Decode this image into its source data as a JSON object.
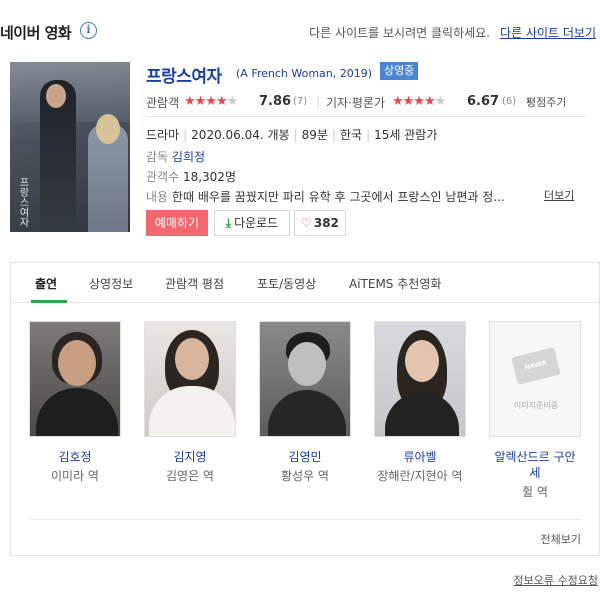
{
  "header": {
    "brand": "네이버 영화",
    "info_icon": "info-icon",
    "other_site_hint": "다른 사이트를 보시려면 클릭하세요.",
    "other_site_link": "다른 사이트 더보기"
  },
  "movie": {
    "poster_title": "프랑스여자",
    "title": "프랑스여자",
    "subtitle": "(A French Woman, 2019)",
    "status_badge": "상영중",
    "audience_label": "관람객",
    "audience_score": "7.86",
    "audience_stars": 4,
    "audience_count": "(7)",
    "critic_label": "기자·평론가",
    "critic_score": "6.67",
    "critic_stars": 3.5,
    "critic_count": "(6)",
    "rate_link": "평점주기",
    "genre": "드라마",
    "release": "2020.06.04. 개봉",
    "runtime": "89분",
    "country": "한국",
    "rating": "15세 관람가",
    "director_label": "감독",
    "director": "김희정",
    "attendance_label": "관객수",
    "attendance": "18,302명",
    "plot_label": "내용",
    "plot": "한때 배우를 꿈꿨지만 파리 유학 후 그곳에서 프랑스인 남편과 정...",
    "more_link": "더보기",
    "reserve_button": "예매하기",
    "download_button": "다운로드",
    "like_count": "382"
  },
  "tabs": [
    {
      "label": "출연"
    },
    {
      "label": "상영정보"
    },
    {
      "label": "관람객 평점"
    },
    {
      "label": "포토/동영상"
    },
    {
      "label": "AiTEMS 추천영화"
    }
  ],
  "cast": [
    {
      "name": "김호정",
      "role": "이미라 역"
    },
    {
      "name": "김지영",
      "role": "김영은 역"
    },
    {
      "name": "김영민",
      "role": "황성우 역"
    },
    {
      "name": "류아벨",
      "role": "장해란/지현아 역"
    },
    {
      "name": "알렉산드르 구안세",
      "role": "쥘 역",
      "no_image_text": "이미지준비중",
      "no_image_badge": "NAVER"
    }
  ],
  "see_all": "전체보기",
  "report_link": "정보오류 수정요청",
  "colors": {
    "link": "#1a3fa6",
    "star": "#e5474d",
    "badge": "#4a86d6",
    "reserve": "#f3686e",
    "tab_active": "#2aa84a"
  }
}
